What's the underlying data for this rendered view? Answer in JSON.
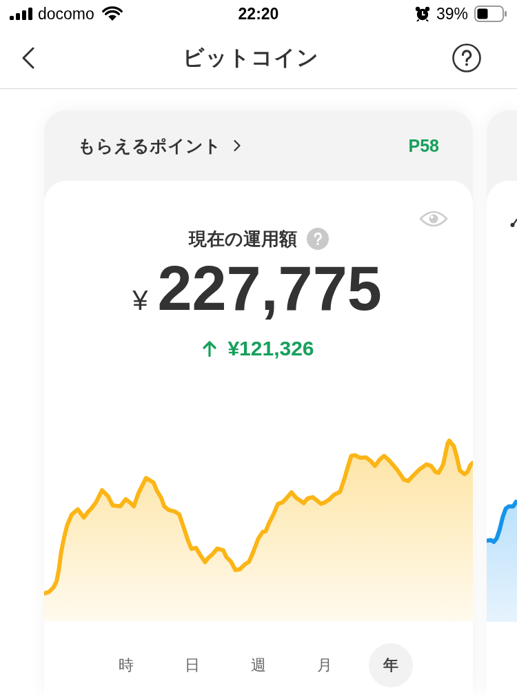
{
  "status_bar": {
    "carrier": "docomo",
    "time": "22:20",
    "battery": "39%"
  },
  "header": {
    "title": "ビットコイン"
  },
  "card": {
    "points_label": "もらえるポイント",
    "points": "P58",
    "balance_label": "現在の運用額",
    "currency": "¥",
    "balance": "227,775",
    "change": "¥121,326",
    "periods": [
      {
        "label": "時",
        "selected": false
      },
      {
        "label": "日",
        "selected": false
      },
      {
        "label": "週",
        "selected": false
      },
      {
        "label": "月",
        "selected": false
      },
      {
        "label": "年",
        "selected": true
      }
    ]
  }
}
